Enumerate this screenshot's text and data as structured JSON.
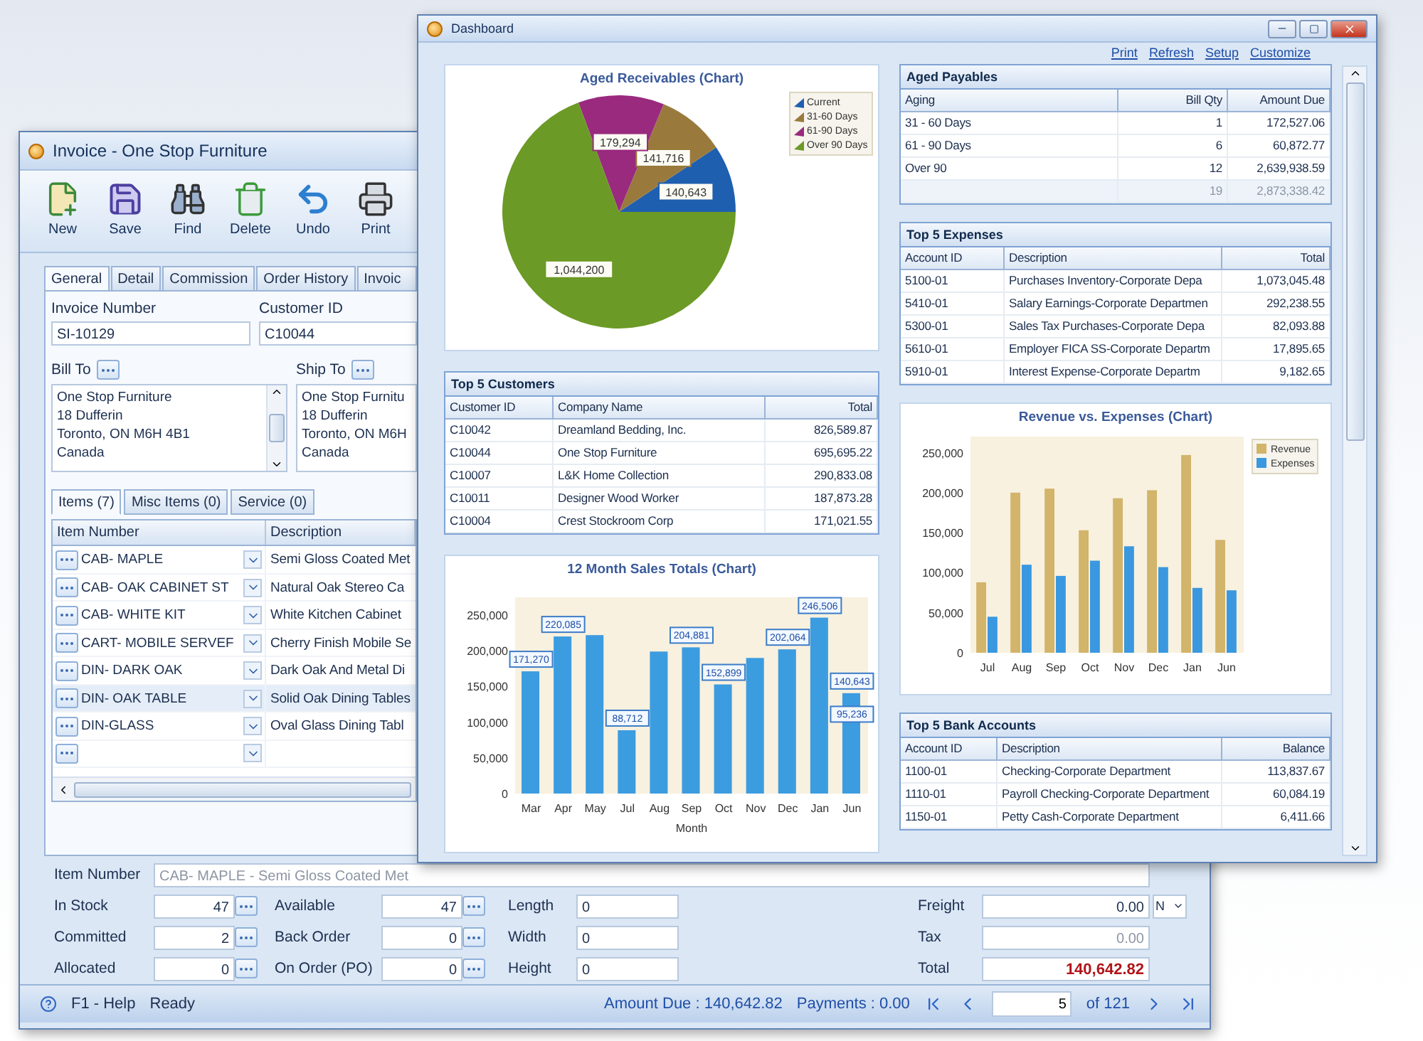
{
  "invoice": {
    "title": "Invoice - One Stop Furniture",
    "toolbar": [
      {
        "label": "New"
      },
      {
        "label": "Save"
      },
      {
        "label": "Find"
      },
      {
        "label": "Delete"
      },
      {
        "label": "Undo"
      },
      {
        "label": "Print"
      }
    ],
    "tabs": [
      {
        "label": "General",
        "selected": true
      },
      {
        "label": "Detail",
        "selected": false
      },
      {
        "label": "Commission",
        "selected": false
      },
      {
        "label": "Order History",
        "selected": false
      },
      {
        "label": "Invoic",
        "selected": false
      }
    ],
    "invoice_number": {
      "label": "Invoice Number",
      "value": "SI-10129"
    },
    "customer_id": {
      "label": "Customer ID",
      "value": "C10044"
    },
    "bill_to": {
      "label": "Bill To",
      "lines": [
        "One Stop Furniture",
        "18 Dufferin",
        "Toronto, ON M6H 4B1",
        "Canada"
      ]
    },
    "ship_to": {
      "label": "Ship To",
      "lines": [
        "One Stop Furnitu",
        "18 Dufferin",
        "Toronto, ON M6H",
        "Canada"
      ]
    },
    "item_tabs": [
      {
        "label": "Items (7)",
        "selected": true
      },
      {
        "label": "Misc Items (0)",
        "selected": false
      },
      {
        "label": "Service (0)",
        "selected": false
      }
    ],
    "items": {
      "columns": [
        "Item Number",
        "Description"
      ],
      "rows": [
        {
          "item": "CAB- MAPLE",
          "description": "Semi Gloss Coated Met",
          "selected": false
        },
        {
          "item": "CAB- OAK CABINET ST",
          "description": "Natural Oak Stereo Ca",
          "selected": false
        },
        {
          "item": "CAB- WHITE KIT",
          "description": "White Kitchen Cabinet",
          "selected": false
        },
        {
          "item": "CART- MOBILE SERVEF",
          "description": "Cherry Finish Mobile Se",
          "selected": false
        },
        {
          "item": "DIN- DARK OAK",
          "description": "Dark Oak And Metal Di",
          "selected": false
        },
        {
          "item": "DIN- OAK TABLE",
          "description": "Solid Oak Dining Tables",
          "selected": true
        },
        {
          "item": "DIN-GLASS",
          "description": "Oval Glass Dining Tabl",
          "selected": false
        }
      ]
    },
    "item_number": {
      "label": "Item Number",
      "value": "CAB- MAPLE - Semi Gloss Coated Met"
    },
    "details": [
      [
        {
          "kind": "lookup",
          "label": "In Stock",
          "value": "47"
        },
        {
          "kind": "lookup",
          "label": "Available",
          "value": "47"
        },
        {
          "kind": "plain",
          "label": "Length",
          "value": "0"
        },
        {
          "kind": "amount",
          "label": "Freight",
          "value": "0.00",
          "option": "N"
        }
      ],
      [
        {
          "kind": "lookup",
          "label": "Committed",
          "value": "2"
        },
        {
          "kind": "lookup",
          "label": "Back Order",
          "value": "0"
        },
        {
          "kind": "plain",
          "label": "Width",
          "value": "0"
        },
        {
          "kind": "readonly",
          "label": "Tax",
          "value": "0.00"
        }
      ],
      [
        {
          "kind": "lookup",
          "label": "Allocated",
          "value": "0"
        },
        {
          "kind": "lookup",
          "label": "On Order (PO)",
          "value": "0"
        },
        {
          "kind": "plain",
          "label": "Height",
          "value": "0"
        },
        {
          "kind": "total",
          "label": "Total",
          "value": "140,642.82"
        }
      ]
    ],
    "status": {
      "help": "F1 - Help",
      "state": "Ready",
      "amount_due": "Amount Due : 140,642.82",
      "payments": "Payments : 0.00",
      "page": "5",
      "page_count": "of 121"
    }
  },
  "dashboard": {
    "title": "Dashboard",
    "links": [
      "Print",
      "Refresh",
      "Setup",
      "Customize"
    ],
    "aged_receivables": {
      "chart_data": {
        "type": "pie",
        "title": "Aged Receivables (Chart)",
        "legend": "right",
        "categories": [
          "Current",
          "31-60 Days",
          "61-90 Days",
          "Over 90 Days"
        ],
        "values": [
          140643,
          141716,
          179294,
          1044200
        ],
        "value_labels": [
          "140,643",
          "141,716",
          "179,294",
          "1,044,200"
        ]
      }
    },
    "top_customers": {
      "title": "Top 5 Customers",
      "columns": [
        "Customer ID",
        "Company Name",
        "Total"
      ],
      "rows": [
        [
          "C10042",
          "Dreamland Bedding, Inc.",
          "826,589.87"
        ],
        [
          "C10044",
          "One Stop Furniture",
          "695,695.22"
        ],
        [
          "C10007",
          "L&K Home Collection",
          "290,833.08"
        ],
        [
          "C10011",
          "Designer Wood Worker",
          "187,873.28"
        ],
        [
          "C10004",
          "Crest Stockroom Corp",
          "171,021.55"
        ]
      ]
    },
    "sales": {
      "chart_data": {
        "type": "bar",
        "title": "12 Month Sales Totals (Chart)",
        "xlabel": "Month",
        "categories": [
          "Mar",
          "Apr",
          "May",
          "Jul",
          "Aug",
          "Sep",
          "Oct",
          "Nov",
          "Dec",
          "Jan",
          "Jun"
        ],
        "values": [
          171270,
          220085,
          222000,
          88712,
          199000,
          204881,
          152899,
          190000,
          202064,
          246506,
          140643
        ],
        "value_labels": [
          "171,270",
          "220,085",
          null,
          "88,712",
          null,
          "204,881",
          "152,899",
          null,
          "202,064",
          "246,506",
          "140,643"
        ],
        "annotations": [
          "95,236"
        ],
        "ylim": [
          0,
          275000
        ],
        "yticks": [
          0,
          {
            "value": 50000,
            "label": "50,000"
          },
          {
            "value": 100000,
            "label": "100,000"
          },
          {
            "value": 150000,
            "label": "150,000"
          },
          {
            "value": 200000,
            "label": "200,000"
          },
          {
            "value": 250000,
            "label": "250,000"
          }
        ]
      }
    },
    "aged_payables": {
      "title": "Aged Payables",
      "columns": [
        "Aging",
        "Bill Qty",
        "Amount Due"
      ],
      "rows": [
        [
          "31 - 60 Days",
          "1",
          "172,527.06"
        ],
        [
          "61 - 90 Days",
          "6",
          "60,872.77"
        ],
        [
          "Over 90",
          "12",
          "2,639,938.59"
        ]
      ],
      "totals": [
        "19",
        "2,873,338.42"
      ]
    },
    "top_expenses": {
      "title": "Top 5 Expenses",
      "columns": [
        "Account ID",
        "Description",
        "Total"
      ],
      "rows": [
        [
          "5100-01",
          "Purchases Inventory-Corporate Depa",
          "1,073,045.48"
        ],
        [
          "5410-01",
          "Salary Earnings-Corporate Departmen",
          "292,238.55"
        ],
        [
          "5300-01",
          "Sales Tax Purchases-Corporate Depa",
          "82,093.88"
        ],
        [
          "5610-01",
          "Employer FICA SS-Corporate Departm",
          "17,895.65"
        ],
        [
          "5910-01",
          "Interest Expense-Corporate Departm",
          "9,182.65"
        ]
      ]
    },
    "revenue_expenses": {
      "chart_data": {
        "type": "bar",
        "title": "Revenue vs. Expenses (Chart)",
        "categories": [
          "Jul",
          "Aug",
          "Sep",
          "Oct",
          "Nov",
          "Dec",
          "Jan",
          "Jun"
        ],
        "series": [
          {
            "name": "Revenue",
            "color": "#d2b46a",
            "values": [
              88000,
              200000,
              205000,
              153000,
              193000,
              203000,
              247000,
              141000
            ]
          },
          {
            "name": "Expenses",
            "color": "#3a98e0",
            "values": [
              45000,
              110000,
              96000,
              115000,
              133000,
              107000,
              81000,
              78000
            ]
          }
        ],
        "ylim": [
          0,
          270000
        ],
        "legend": "right",
        "yticks": [
          0,
          {
            "value": 50000,
            "label": "50,000"
          },
          {
            "value": 100000,
            "label": "100,000"
          },
          {
            "value": 150000,
            "label": "150,000"
          },
          {
            "value": 200000,
            "label": "200,000"
          },
          {
            "value": 250000,
            "label": "250,000"
          }
        ]
      }
    },
    "bank_accounts": {
      "title": "Top 5 Bank Accounts",
      "columns": [
        "Account ID",
        "Description",
        "Balance"
      ],
      "rows": [
        [
          "1100-01",
          "Checking-Corporate Department",
          "113,837.67"
        ],
        [
          "1110-01",
          "Payroll Checking-Corporate Department",
          "60,084.19"
        ],
        [
          "1150-01",
          "Petty Cash-Corporate Department",
          "6,411.66"
        ]
      ]
    }
  }
}
